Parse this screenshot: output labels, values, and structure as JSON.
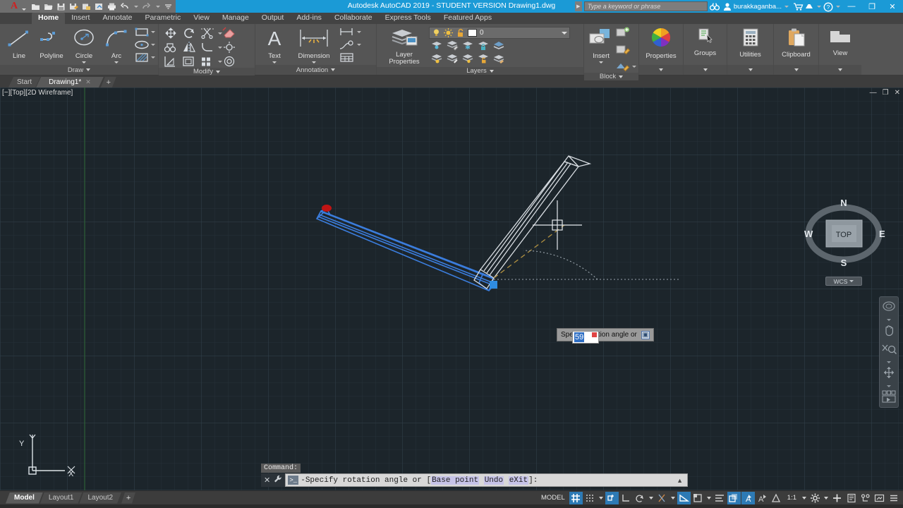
{
  "titlebar": {
    "app_menu_icon": "autocad-a-icon",
    "quick_access": [
      {
        "name": "new-icon",
        "label": "New"
      },
      {
        "name": "open-icon",
        "label": "Open"
      },
      {
        "name": "save-icon",
        "label": "Save"
      },
      {
        "name": "save-as-icon",
        "label": "Save As"
      },
      {
        "name": "plot-preview-icon",
        "label": "Plot Preview"
      },
      {
        "name": "publish-icon",
        "label": "Publish"
      },
      {
        "name": "print-icon",
        "label": "Print"
      },
      {
        "name": "undo-icon",
        "label": "Undo"
      },
      {
        "name": "redo-icon",
        "label": "Redo"
      },
      {
        "name": "customize-qat-icon",
        "label": "Customize"
      }
    ],
    "title": "Autodesk AutoCAD 2019 - STUDENT VERSION    Drawing1.dwg",
    "search_placeholder": "Type a keyword or phrase",
    "account_name": "burakkaganba...",
    "icons": {
      "search": "binoculars-icon",
      "account": "user-account-icon",
      "store": "autodesk-store-icon",
      "cloud": "autodesk-cloud-icon",
      "help": "help-question-icon"
    },
    "window_buttons": {
      "minimize": "—",
      "maximize": "❐",
      "close": "✕"
    }
  },
  "ribbon_tabs": [
    {
      "label": "Home",
      "active": true
    },
    {
      "label": "Insert",
      "active": false
    },
    {
      "label": "Annotate",
      "active": false
    },
    {
      "label": "Parametric",
      "active": false
    },
    {
      "label": "View",
      "active": false
    },
    {
      "label": "Manage",
      "active": false
    },
    {
      "label": "Output",
      "active": false
    },
    {
      "label": "Add-ins",
      "active": false
    },
    {
      "label": "Collaborate",
      "active": false
    },
    {
      "label": "Express Tools",
      "active": false
    },
    {
      "label": "Featured Apps",
      "active": false
    }
  ],
  "ribbon_panels": {
    "draw": {
      "title": "Draw",
      "big_buttons": [
        {
          "label": "Line",
          "icon": "line-icon"
        },
        {
          "label": "Polyline",
          "icon": "polyline-icon"
        },
        {
          "label": "Circle",
          "icon": "circle-icon"
        },
        {
          "label": "Arc",
          "icon": "arc-icon"
        }
      ],
      "small_buttons": [
        {
          "name": "rectangle-icon"
        },
        {
          "name": "ellipse-icon"
        },
        {
          "name": "hatch-icon"
        }
      ]
    },
    "modify": {
      "title": "Modify",
      "small_buttons": [
        {
          "name": "move-icon"
        },
        {
          "name": "rotate-icon"
        },
        {
          "name": "trim-icon"
        },
        {
          "name": "erase-icon"
        },
        {
          "name": "copy-icon"
        },
        {
          "name": "mirror-icon"
        },
        {
          "name": "fillet-icon"
        },
        {
          "name": "explode-icon"
        },
        {
          "name": "stretch-icon"
        },
        {
          "name": "scale-icon"
        },
        {
          "name": "array-icon"
        },
        {
          "name": "offset-icon"
        }
      ]
    },
    "annotation": {
      "title": "Annotation",
      "big_buttons": [
        {
          "label": "Text",
          "icon": "text-a-icon"
        },
        {
          "label": "Dimension",
          "icon": "dimension-icon"
        }
      ],
      "small_buttons": [
        {
          "name": "linear-dimension-icon"
        },
        {
          "name": "leader-icon"
        },
        {
          "name": "table-icon"
        }
      ]
    },
    "layers": {
      "title": "Layers",
      "big_buttons": [
        {
          "label": "Layer\nProperties",
          "icon": "layer-properties-icon"
        }
      ],
      "current_layer": "0",
      "layer_state_icons": [
        "lightbulb-icon",
        "sun-icon",
        "unlock-icon"
      ],
      "small_buttons": [
        {
          "name": "layer-isolate-icon"
        },
        {
          "name": "layer-edit-icon"
        },
        {
          "name": "layer-freeze-icon"
        },
        {
          "name": "layer-lock-icon"
        },
        {
          "name": "layer-merge-icon"
        },
        {
          "name": "layer-off-icon"
        },
        {
          "name": "layer-unisolate-icon"
        },
        {
          "name": "layer-thaw-icon"
        },
        {
          "name": "layer-unlock-icon"
        },
        {
          "name": "layer-delete-icon"
        }
      ]
    },
    "block": {
      "title": "Block",
      "big_buttons": [
        {
          "label": "Insert",
          "icon": "insert-block-icon"
        }
      ],
      "small_buttons": [
        {
          "name": "create-block-icon"
        },
        {
          "name": "edit-block-icon"
        },
        {
          "name": "edit-attribute-icon"
        }
      ]
    },
    "properties": {
      "title": "Properties",
      "label": "Properties",
      "icon": "properties-color-wheel-icon"
    },
    "groups": {
      "title": "Groups",
      "label": "Groups",
      "icon": "group-icon"
    },
    "utilities": {
      "title": "Utilities",
      "label": "Utilities",
      "icon": "utilities-calculator-icon"
    },
    "clipboard": {
      "title": "Clipboard",
      "label": "Clipboard",
      "icon": "clipboard-icon"
    },
    "view": {
      "title": "View",
      "label": "View",
      "icon": "view-window-icon"
    }
  },
  "file_tabs": [
    {
      "label": "Start",
      "active": false,
      "closeable": false
    },
    {
      "label": "Drawing1*",
      "active": true,
      "closeable": true,
      "close_glyph": "✕"
    }
  ],
  "file_tab_add": "+",
  "canvas": {
    "viewport_label": "[−][Top][2D Wireframe]",
    "viewport_controls": {
      "minimize": "—",
      "restore": "❐",
      "close": "✕"
    },
    "viewcube": {
      "top": "TOP",
      "north": "N",
      "east": "E",
      "south": "S",
      "west": "W"
    },
    "wcs_label": "WCS",
    "nav_icons": [
      "steering-wheel-icon",
      "pan-hand-icon",
      "zoom-icon",
      "orbit-icon",
      "showmotion-icon"
    ],
    "ucs": {
      "x_label": "X",
      "y_label": "Y"
    },
    "background_color": "#1c252b",
    "selection_color": "#3b7ddd",
    "ghost_color": "#d8dde2",
    "grip_hot_color": "#d01010",
    "grip_cold_color": "#2f8ce0",
    "rubber_band_color": "#b09040"
  },
  "dynamic_input": {
    "prompt": "Specify rotation angle or",
    "expand_glyph": "▣",
    "value": "59"
  },
  "command_line": {
    "history": "Command:",
    "prompt_glyph": ">_",
    "text_prefix": "-Specify rotation angle or [",
    "keywords": [
      "Base point",
      "Undo",
      "eXit"
    ],
    "text_suffix": "]:",
    "close_glyph": "✕",
    "wrench_glyph": "🔧",
    "expand_glyph": "▲"
  },
  "status_bar": {
    "layout_tabs": [
      {
        "label": "Model",
        "active": true
      },
      {
        "label": "Layout1",
        "active": false
      },
      {
        "label": "Layout2",
        "active": false
      }
    ],
    "layout_add": "+",
    "space_label": "MODEL",
    "scale": "1:1",
    "toggles": [
      {
        "name": "grid-display-toggle",
        "glyph": "#",
        "on": true
      },
      {
        "name": "snap-mode-toggle",
        "glyph": "∷",
        "on": false,
        "dropdown": true
      },
      {
        "name": "dynamic-ucs-toggle",
        "glyph": "⌐",
        "on": true
      },
      {
        "name": "ortho-mode-toggle",
        "glyph": "∟",
        "on": false
      },
      {
        "name": "polar-tracking-toggle",
        "glyph": "⥁",
        "on": false,
        "dropdown": true
      },
      {
        "name": "object-snap-toggle",
        "glyph": "╱",
        "on": false,
        "dropdown": true
      },
      {
        "name": "object-snap-tracking-toggle",
        "glyph": "∠",
        "on": true
      },
      {
        "name": "lineweight-toggle",
        "glyph": "⬚",
        "on": false,
        "dropdown": true
      },
      {
        "name": "transparency-toggle",
        "glyph": "≡",
        "on": false
      },
      {
        "name": "selection-cycling-toggle",
        "glyph": "⧉",
        "on": true
      },
      {
        "name": "annotation-visibility-toggle",
        "glyph": "A",
        "on": true
      },
      {
        "name": "autoscale-toggle",
        "glyph": "A",
        "on": false
      },
      {
        "name": "annotation-scale-icon",
        "glyph": "∴",
        "on": false
      },
      {
        "name": "workspace-settings-icon",
        "glyph": "⚙",
        "on": false,
        "dropdown": true
      },
      {
        "name": "isolate-objects-icon",
        "glyph": "✚",
        "on": false
      },
      {
        "name": "hardware-acceleration-icon",
        "glyph": "⌸",
        "on": false
      },
      {
        "name": "clean-screen-icon",
        "glyph": "⛶",
        "on": false
      },
      {
        "name": "customization-icon",
        "glyph": "☰",
        "on": false
      }
    ]
  }
}
